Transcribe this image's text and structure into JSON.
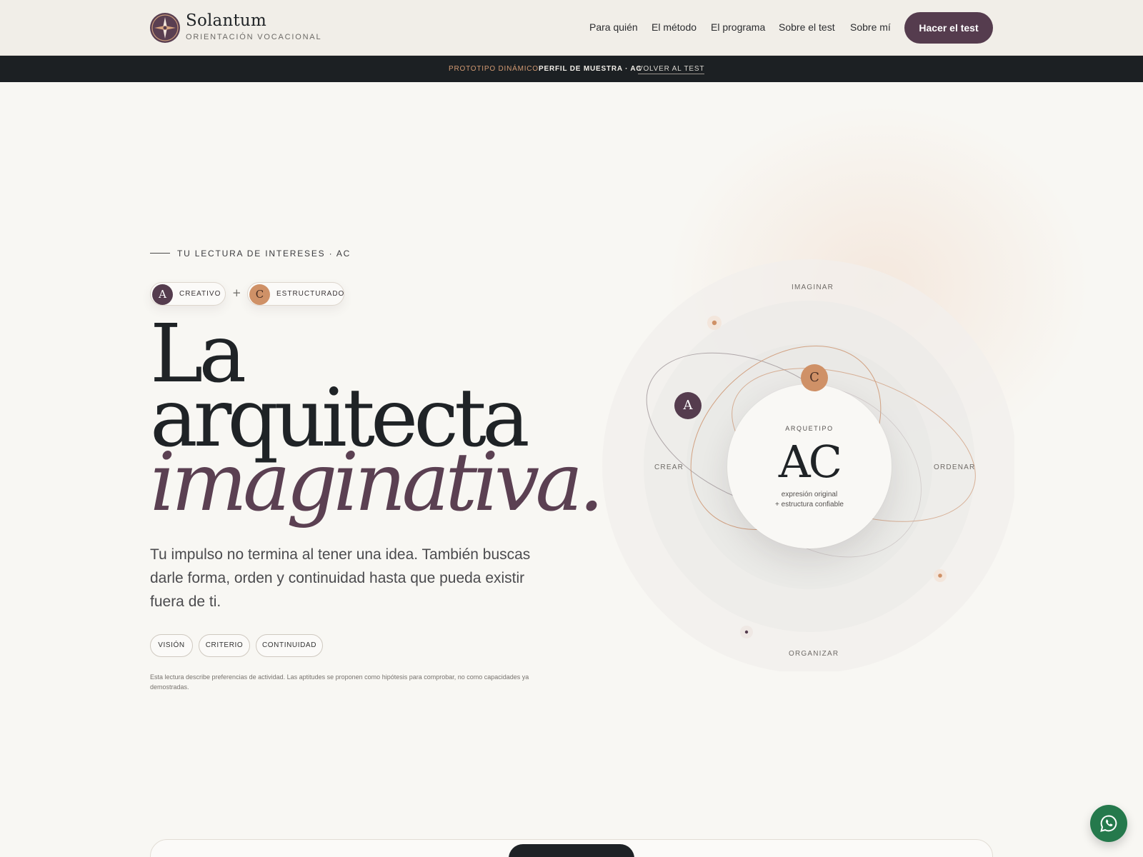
{
  "brand": {
    "name": "Solantum",
    "tagline": "ORIENTACIÓN VOCACIONAL"
  },
  "nav": {
    "items": [
      "Para quién",
      "El método",
      "El programa",
      "Sobre el test",
      "Sobre mí"
    ],
    "cta": "Hacer el test"
  },
  "banner": {
    "prototype": "PROTOTIPO DINÁMICO",
    "sample": "PERFIL DE MUESTRA · AC",
    "back": "VOLVER AL TEST"
  },
  "hero": {
    "eyebrow": "TU LECTURA DE INTERESES · AC",
    "chips": [
      {
        "letter": "A",
        "label": "CREATIVO"
      },
      {
        "letter": "C",
        "label": "ESTRUCTURADO"
      }
    ],
    "plus": "+",
    "headline": [
      "La",
      "arquitecta",
      "imaginativa."
    ],
    "lede": "Tu impulso no termina al tener una idea. También buscas darle forma, orden y continuidad hasta que pueda existir fuera de ti.",
    "tags": [
      "VISIÓN",
      "CRITERIO",
      "CONTINUIDAD"
    ],
    "disclaimer": "Esta lectura describe preferencias de actividad. Las aptitudes se proponen como hipótesis para comprobar, no como capacidades ya demostradas."
  },
  "diagram": {
    "axes": {
      "top": "IMAGINAR",
      "left": "CREAR",
      "right": "ORDENAR",
      "bottom": "ORGANIZAR"
    },
    "core": {
      "eyebrow": "ARQUETIPO",
      "code": "AC",
      "desc_line1": "expresión original",
      "desc_line2": "+ estructura confiable"
    },
    "nodes": {
      "a": "A",
      "c": "C"
    }
  },
  "colors": {
    "accent_plum": "#553c4e",
    "accent_copper": "#cf9167",
    "banner_bg": "#1c2023",
    "whatsapp_green": "#25794c"
  },
  "icons": {
    "logo": "compass-rose-icon",
    "floating_action": "whatsapp-icon"
  }
}
